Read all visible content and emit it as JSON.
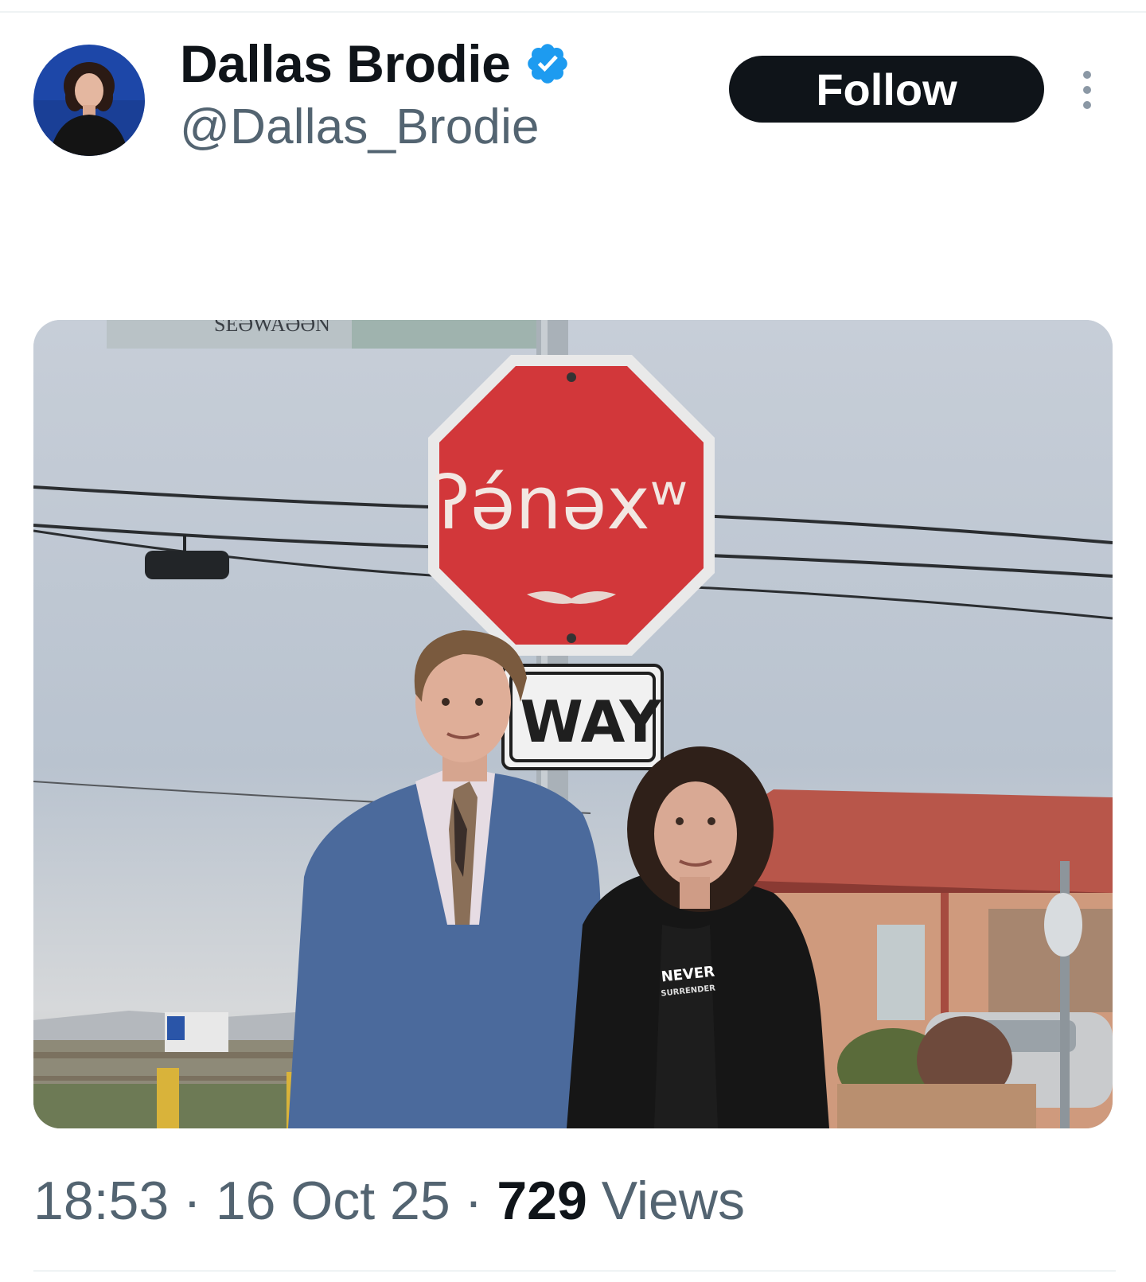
{
  "tweet": {
    "author": {
      "display_name": "Dallas Brodie",
      "handle": "@Dallas_Brodie",
      "verified": true,
      "verified_color": "#1d9bf0"
    },
    "follow_label": "Follow",
    "more_icon": "more-vertical-icon",
    "media": {
      "sign_text": "ʔə́nəxʷ",
      "way_sign_text": "WAY",
      "street_sign_text": "SEƏWAƏƏN",
      "shirt_text": "NEVER",
      "shirt_subtext": "SURRENDER"
    },
    "meta": {
      "time": "18:53",
      "separator": "·",
      "date": "16 Oct 25",
      "views_count": "729",
      "views_label": "Views"
    }
  }
}
